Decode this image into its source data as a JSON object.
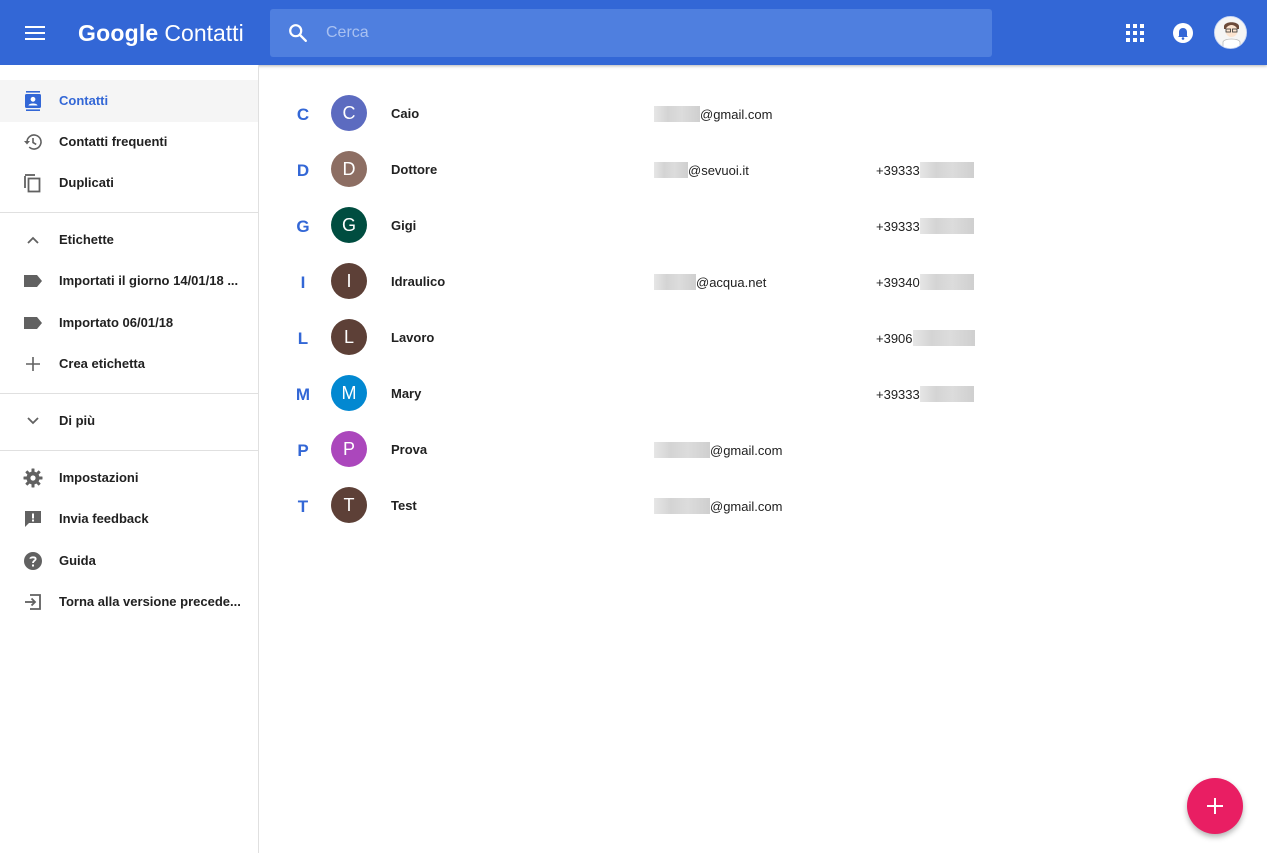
{
  "header": {
    "brand_google": "Google",
    "brand_product": "Contatti",
    "search_placeholder": "Cerca"
  },
  "sidebar": {
    "main": [
      {
        "label": "Contatti",
        "icon": "contacts-icon",
        "active": true
      },
      {
        "label": "Contatti frequenti",
        "icon": "history-icon"
      },
      {
        "label": "Duplicati",
        "icon": "copy-icon"
      }
    ],
    "labels_header": "Etichette",
    "labels": [
      {
        "label": "Importati il giorno 14/01/18 ...",
        "icon": "label-icon"
      },
      {
        "label": "Importato 06/01/18",
        "icon": "label-icon"
      },
      {
        "label": "Crea etichetta",
        "icon": "plus-icon"
      }
    ],
    "more": "Di più",
    "footer": [
      {
        "label": "Impostazioni",
        "icon": "gear-icon"
      },
      {
        "label": "Invia feedback",
        "icon": "feedback-icon"
      },
      {
        "label": "Guida",
        "icon": "help-icon"
      },
      {
        "label": "Torna alla versione precede...",
        "icon": "exit-icon"
      }
    ]
  },
  "contacts": [
    {
      "letter": "C",
      "initial": "C",
      "name": "Caio",
      "email": "@gmail.com",
      "phone": "",
      "color": "#5c6bc0"
    },
    {
      "letter": "D",
      "initial": "D",
      "name": "Dottore",
      "email": "@sevuoi.it",
      "phone": "+39333",
      "color": "#8d6e63"
    },
    {
      "letter": "G",
      "initial": "G",
      "name": "Gigi",
      "email": "",
      "phone": "+39333",
      "color": "#004d40"
    },
    {
      "letter": "I",
      "initial": "I",
      "name": "Idraulico",
      "email": "@acqua.net",
      "phone": "+39340",
      "color": "#5d4037"
    },
    {
      "letter": "L",
      "initial": "L",
      "name": "Lavoro",
      "email": "",
      "phone": "+3906",
      "color": "#5d4037"
    },
    {
      "letter": "M",
      "initial": "M",
      "name": "Mary",
      "email": "",
      "phone": "+39333",
      "color": "#0288d1"
    },
    {
      "letter": "P",
      "initial": "P",
      "name": "Prova",
      "email": "@gmail.com",
      "phone": "",
      "color": "#ab47bc"
    },
    {
      "letter": "T",
      "initial": "T",
      "name": "Test",
      "email": "@gmail.com",
      "phone": "",
      "color": "#5d4037"
    }
  ],
  "colors": {
    "primary": "#3367d6",
    "fab": "#e91e63"
  }
}
